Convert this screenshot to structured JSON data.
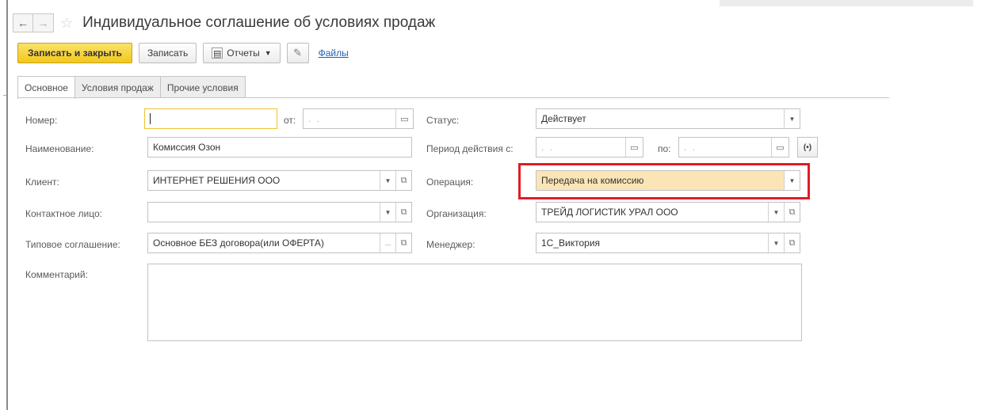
{
  "window": {
    "title": "Индивидуальное соглашение об условиях продаж",
    "back_glyph": "←",
    "forward_glyph": "→",
    "star_glyph": "☆"
  },
  "toolbar": {
    "save_close_label": "Записать и закрыть",
    "save_label": "Записать",
    "reports_label": "Отчеты",
    "files_link": "Файлы"
  },
  "tabs": [
    {
      "label": "Основное",
      "active": true
    },
    {
      "label": "Условия продаж",
      "active": false
    },
    {
      "label": "Прочие условия",
      "active": false
    }
  ],
  "fields": {
    "number": {
      "label": "Номер:",
      "value": ""
    },
    "date_from": {
      "label": "от:",
      "value": ". ."
    },
    "name": {
      "label": "Наименование:",
      "value": "Комиссия Озон"
    },
    "client": {
      "label": "Клиент:",
      "value": "ИНТЕРНЕТ РЕШЕНИЯ ООО"
    },
    "contact": {
      "label": "Контактное лицо:",
      "value": ""
    },
    "template": {
      "label": "Типовое соглашение:",
      "value": "Основное БЕЗ договора(или ОФЕРТА)"
    },
    "comment": {
      "label": "Комментарий:",
      "value": ""
    },
    "status": {
      "label": "Статус:",
      "value": "Действует"
    },
    "period_from": {
      "label": "Период действия с:",
      "value": ". ."
    },
    "period_to": {
      "label": "по:",
      "value": ". ."
    },
    "operation": {
      "label": "Операция:",
      "value": "Передача на комиссию"
    },
    "organization": {
      "label": "Организация:",
      "value": "ТРЕЙД ЛОГИСТИК УРАЛ ООО"
    },
    "manager": {
      "label": "Менеджер:",
      "value": "1С_Виктория"
    }
  },
  "period_button_glyph": "(•)",
  "colors": {
    "primary_button": "#f2c81c",
    "highlight_field": "#fbe5b6",
    "annotation_box": "#e11b24",
    "link": "#1f5fb4"
  }
}
